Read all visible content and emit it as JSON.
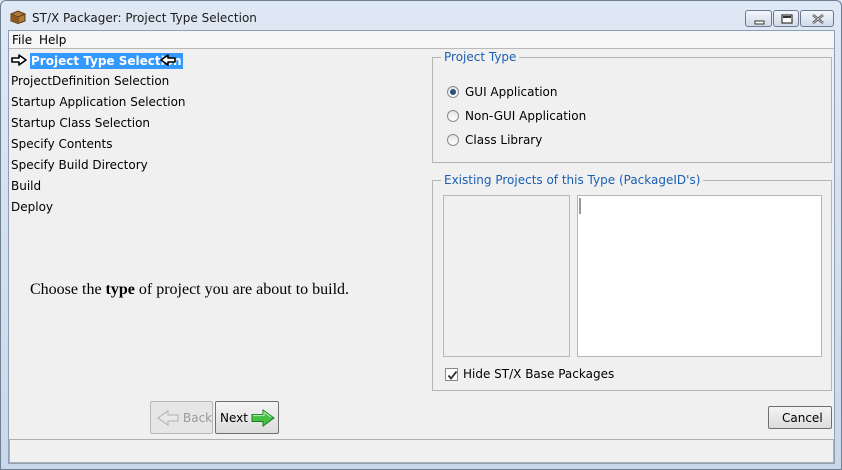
{
  "window": {
    "title": "ST/X Packager: Project Type Selection"
  },
  "menu": {
    "items": [
      "File",
      "Help"
    ]
  },
  "steps": {
    "items": [
      "Project Type Selection",
      "ProjectDefinition Selection",
      "Startup Application Selection",
      "Startup Class Selection",
      "Specify Contents",
      "Specify Build Directory",
      "Build",
      "Deploy"
    ],
    "current_index": 0
  },
  "hint": {
    "prefix": "Choose the ",
    "emphasis": "type",
    "suffix": " of project you are about to build."
  },
  "project_type": {
    "legend": "Project Type",
    "options": [
      "GUI Application",
      "Non-GUI Application",
      "Class Library"
    ],
    "selected": "GUI Application"
  },
  "existing_projects": {
    "legend": "Existing Projects of this Type (PackageID's)",
    "hide_base_label": "Hide ST/X Base Packages",
    "hide_base_checked": true
  },
  "buttons": {
    "back": "Back",
    "next": "Next",
    "cancel": "Cancel"
  },
  "colors": {
    "selection": "#3399ff",
    "legend_text": "#1a5fb4",
    "next_arrow": "#3fbf3f"
  },
  "icons": {
    "app": "package-icon",
    "back": "arrow-left-icon",
    "next": "arrow-right-icon"
  }
}
